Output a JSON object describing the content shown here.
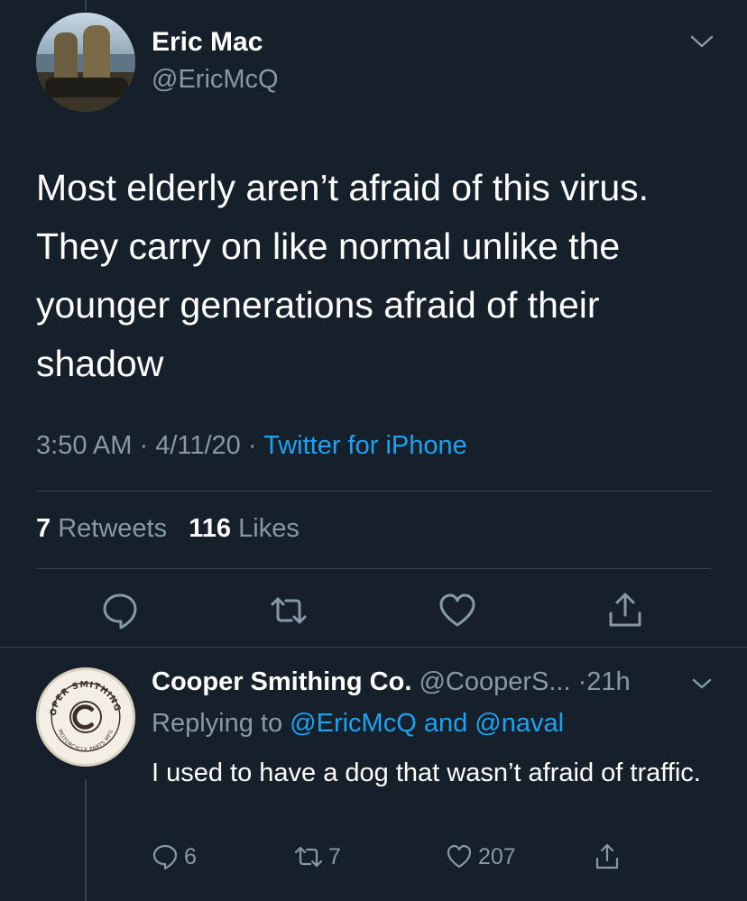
{
  "tweet": {
    "author_name": "Eric Mac",
    "author_handle": "@EricMcQ",
    "text": "Most elderly aren’t afraid of this virus. They carry on like normal unlike the younger generations afraid of their shadow",
    "time": "3:50 AM",
    "date": "4/11/20",
    "sep": "·",
    "source": "Twitter for iPhone",
    "retweet_count": "7",
    "retweet_label": "Retweets",
    "like_count": "116",
    "like_label": "Likes"
  },
  "reply": {
    "author_name": "Cooper Smithing Co.",
    "author_handle": "@CooperS...",
    "age": "·21h",
    "replying_prefix": "Replying to",
    "mention_1": "@EricMcQ",
    "and": "and",
    "mention_2": "@naval",
    "text": "I used to have a dog that wasn’t afraid of traffic.",
    "reply_count": "6",
    "retweet_count": "7",
    "like_count": "207",
    "avatar_text_top": "COOPER SMITHING CO",
    "avatar_text_bottom": "MOTORCYCLE PARTS MFG"
  },
  "colors": {
    "background": "#15202b",
    "secondary_text": "#8899a6",
    "link": "#1da1f2",
    "divider": "#38444d"
  },
  "icons": {
    "chevron": "chevron-down-icon",
    "reply": "reply-icon",
    "retweet": "retweet-icon",
    "like": "heart-icon",
    "share": "share-icon"
  }
}
